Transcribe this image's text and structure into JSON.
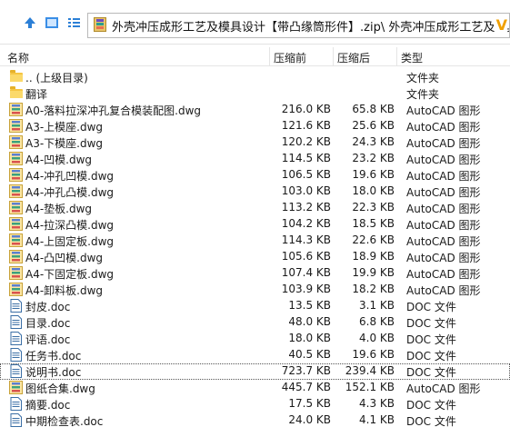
{
  "address": {
    "path": "外壳冲压成形工艺及模具设计【带凸缘筒形件】.zip\\ 外壳冲压成形工艺及模具",
    "overflow_glyph": "V"
  },
  "columns": {
    "name": "名称",
    "size": "压缩前",
    "packed": "压缩后",
    "type": "类型"
  },
  "rows": [
    {
      "name": ".. (上级目录)",
      "size": "",
      "packed": "",
      "type": "文件夹",
      "icon": "folder-up-icon"
    },
    {
      "name": "翻译",
      "size": "",
      "packed": "",
      "type": "文件夹",
      "icon": "folder-icon"
    },
    {
      "name": "A0-落料拉深冲孔复合模装配图.dwg",
      "size": "216.0 KB",
      "packed": "65.8 KB",
      "type": "AutoCAD 图形",
      "icon": "dwg-file-icon"
    },
    {
      "name": "A3-上模座.dwg",
      "size": "121.6 KB",
      "packed": "25.6 KB",
      "type": "AutoCAD 图形",
      "icon": "dwg-file-icon"
    },
    {
      "name": "A3-下模座.dwg",
      "size": "120.2 KB",
      "packed": "24.3 KB",
      "type": "AutoCAD 图形",
      "icon": "dwg-file-icon"
    },
    {
      "name": "A4-凹模.dwg",
      "size": "114.5 KB",
      "packed": "23.2 KB",
      "type": "AutoCAD 图形",
      "icon": "dwg-file-icon"
    },
    {
      "name": "A4-冲孔凹模.dwg",
      "size": "106.5 KB",
      "packed": "19.6 KB",
      "type": "AutoCAD 图形",
      "icon": "dwg-file-icon"
    },
    {
      "name": "A4-冲孔凸模.dwg",
      "size": "103.0 KB",
      "packed": "18.0 KB",
      "type": "AutoCAD 图形",
      "icon": "dwg-file-icon"
    },
    {
      "name": "A4-垫板.dwg",
      "size": "113.2 KB",
      "packed": "22.3 KB",
      "type": "AutoCAD 图形",
      "icon": "dwg-file-icon"
    },
    {
      "name": "A4-拉深凸模.dwg",
      "size": "104.2 KB",
      "packed": "18.5 KB",
      "type": "AutoCAD 图形",
      "icon": "dwg-file-icon"
    },
    {
      "name": "A4-上固定板.dwg",
      "size": "114.3 KB",
      "packed": "22.6 KB",
      "type": "AutoCAD 图形",
      "icon": "dwg-file-icon"
    },
    {
      "name": "A4-凸凹模.dwg",
      "size": "105.6 KB",
      "packed": "18.9 KB",
      "type": "AutoCAD 图形",
      "icon": "dwg-file-icon"
    },
    {
      "name": "A4-下固定板.dwg",
      "size": "107.4 KB",
      "packed": "19.9 KB",
      "type": "AutoCAD 图形",
      "icon": "dwg-file-icon"
    },
    {
      "name": "A4-卸料板.dwg",
      "size": "103.9 KB",
      "packed": "18.2 KB",
      "type": "AutoCAD 图形",
      "icon": "dwg-file-icon"
    },
    {
      "name": "封皮.doc",
      "size": "13.5 KB",
      "packed": "3.1 KB",
      "type": "DOC 文件",
      "icon": "doc-file-icon"
    },
    {
      "name": "目录.doc",
      "size": "48.0 KB",
      "packed": "6.8 KB",
      "type": "DOC 文件",
      "icon": "doc-file-icon"
    },
    {
      "name": "评语.doc",
      "size": "18.0 KB",
      "packed": "4.0 KB",
      "type": "DOC 文件",
      "icon": "doc-file-icon"
    },
    {
      "name": "任务书.doc",
      "size": "40.5 KB",
      "packed": "19.6 KB",
      "type": "DOC 文件",
      "icon": "doc-file-icon"
    },
    {
      "name": "说明书.doc",
      "size": "723.7 KB",
      "packed": "239.4 KB",
      "type": "DOC 文件",
      "icon": "doc-file-icon",
      "selected": true
    },
    {
      "name": "图纸合集.dwg",
      "size": "445.7 KB",
      "packed": "152.1 KB",
      "type": "AutoCAD 图形",
      "icon": "dwg-file-icon"
    },
    {
      "name": "摘要.doc",
      "size": "17.5 KB",
      "packed": "4.3 KB",
      "type": "DOC 文件",
      "icon": "doc-file-icon"
    },
    {
      "name": "中期检查表.doc",
      "size": "24.0 KB",
      "packed": "4.1 KB",
      "type": "DOC 文件",
      "icon": "doc-file-icon"
    }
  ]
}
